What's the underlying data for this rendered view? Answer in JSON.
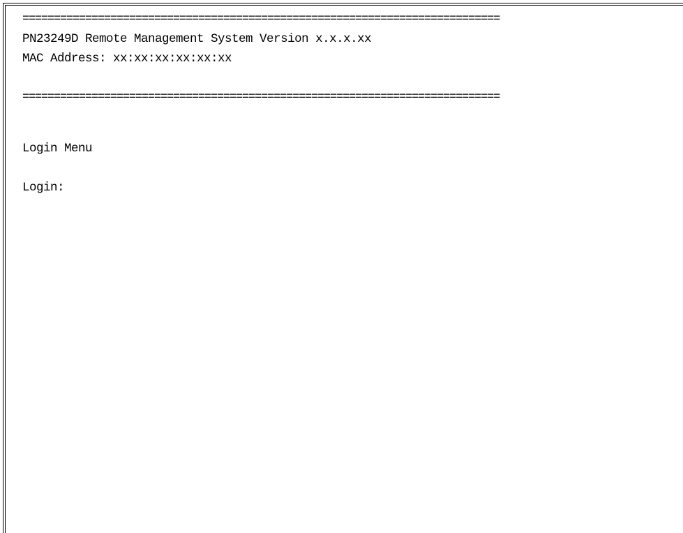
{
  "terminal": {
    "separator": "============================================================================",
    "header_title": "PN23249D Remote Management System Version x.x.x.xx",
    "mac_line": "MAC Address: xx:xx:xx:xx:xx:xx",
    "menu_title": "Login Menu",
    "login_prompt": "Login:",
    "login_value": ""
  }
}
